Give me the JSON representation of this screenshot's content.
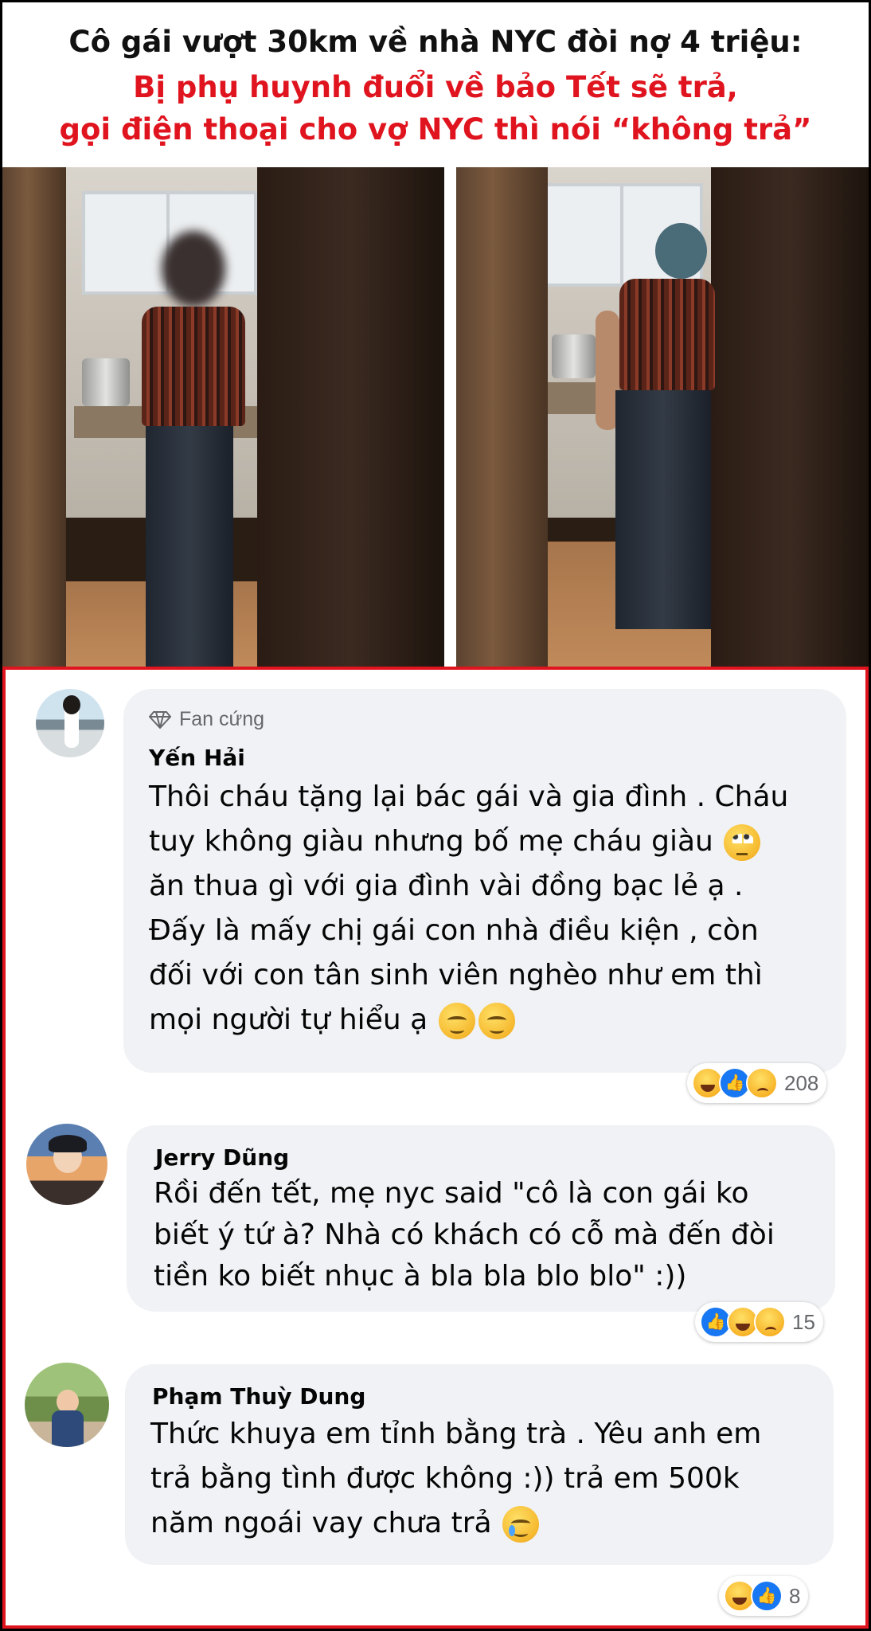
{
  "headline": {
    "line1": "Cô gái vượt 30km về nhà NYC đòi nợ 4 triệu:",
    "line2": "Bị phụ huynh đuổi về bảo Tết sẽ trả,",
    "line3": "gọi điện thoại cho vợ NYC thì nói “không trả”"
  },
  "colors": {
    "headline_red": "#e0141e",
    "bubble_bg": "#f0f2f5",
    "like_blue": "#1877f2"
  },
  "comments": [
    {
      "badge": "Fan cứng",
      "name": "Yến Hải",
      "text": "Thôi cháu tặng lại bác gái và gia đình . Cháu\ntuy không giàu nhưng bố mẹ cháu giàu",
      "text2": "ăn thua gì với gia đình vài đồng bạc lẻ ạ .\nĐấy là mấy chị gái con nhà điều kiện , còn\nđối với con tân sinh viên nghèo như em thì\nmọi người tự hiểu ạ",
      "reactions": [
        "haha",
        "like",
        "sad"
      ],
      "count": "208"
    },
    {
      "name": "Jerry Dũng",
      "text": "Rồi đến tết, mẹ nyc said \"cô là con gái ko\nbiết ý tứ à? Nhà có khách có cỗ mà đến đòi\ntiền ko biết nhục à bla bla blo blo\" :))",
      "reactions": [
        "like",
        "haha",
        "sad"
      ],
      "count": "15"
    },
    {
      "name": "Phạm Thuỳ Dung",
      "text": "Thức khuya em tỉnh bằng trà . Yêu anh em\ntrả bằng tình được không :)) trả em 500k\nnăm ngoái vay chưa trả",
      "reactions": [
        "haha",
        "like"
      ],
      "count": "8"
    }
  ],
  "icons": {
    "badge": "diamond-icon",
    "reaction_like": "thumbs-up-icon",
    "reaction_haha": "laughing-face-icon",
    "reaction_sad": "sad-face-icon"
  }
}
